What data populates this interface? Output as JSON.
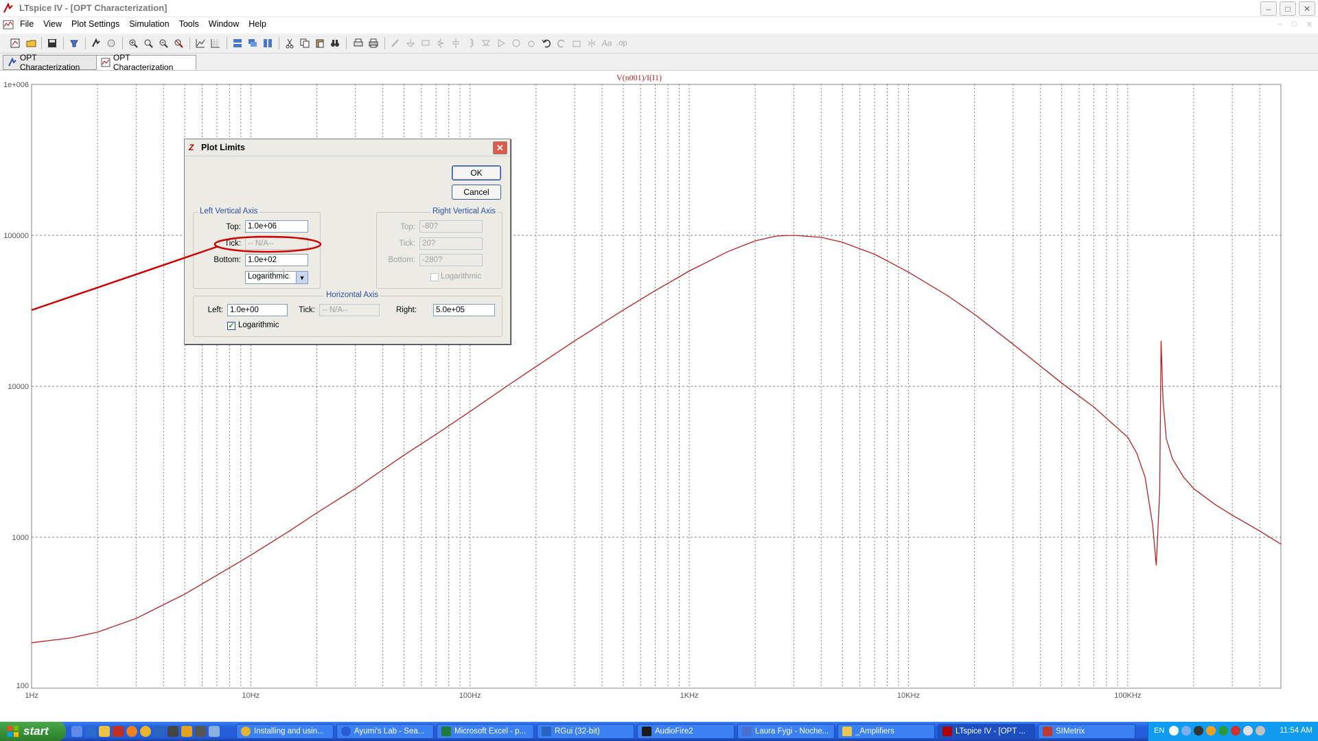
{
  "window": {
    "title": "LTspice IV - [OPT Characterization]"
  },
  "menu": [
    "File",
    "View",
    "Plot Settings",
    "Simulation",
    "Tools",
    "Window",
    "Help"
  ],
  "tabs": [
    {
      "label": "OPT Characterization",
      "icon": "schematic-icon",
      "active": false
    },
    {
      "label": "OPT Characterization",
      "icon": "waveform-icon",
      "active": true
    }
  ],
  "plot": {
    "trace_label": "V(n001)/I(I1)",
    "trace_color": "#b22222",
    "grid_color": "#808080"
  },
  "chart_data": {
    "type": "line",
    "title": "V(n001)/I(I1)",
    "xscale": "log",
    "yscale": "log",
    "xlim": [
      1,
      500000
    ],
    "ylim": [
      100,
      1000000
    ],
    "x_tick_labels": [
      "1Hz",
      "10Hz",
      "100Hz",
      "1KHz",
      "10KHz",
      "100KHz"
    ],
    "y_tick_labels": [
      "1e+006",
      "100000",
      "10000",
      "1000",
      "100"
    ],
    "grid": true,
    "series": [
      {
        "name": "V(n001)/I(I1)",
        "x": [
          1,
          1.5,
          2,
          3,
          5,
          7,
          10,
          15,
          20,
          30,
          50,
          70,
          100,
          150,
          200,
          300,
          500,
          700,
          1000,
          1500,
          2000,
          2500,
          3000,
          4000,
          5000,
          7000,
          10000,
          15000,
          20000,
          30000,
          50000,
          70000,
          100000,
          110000,
          120000,
          130000,
          135000,
          140000,
          142000,
          145000,
          150000,
          160000,
          180000,
          200000,
          250000,
          300000,
          400000,
          500000
        ],
        "y": [
          200,
          215,
          235,
          290,
          420,
          560,
          760,
          1100,
          1450,
          2100,
          3500,
          4800,
          6800,
          10200,
          13500,
          20000,
          32000,
          43000,
          58000,
          78000,
          92000,
          99000,
          100000,
          97000,
          90000,
          75000,
          57000,
          40000,
          30000,
          19000,
          10500,
          7300,
          4600,
          3600,
          2500,
          1200,
          650,
          2000,
          20000,
          8000,
          4500,
          3300,
          2500,
          2100,
          1650,
          1400,
          1100,
          900
        ]
      }
    ]
  },
  "dialog": {
    "title": "Plot Limits",
    "ok_label": "OK",
    "cancel_label": "Cancel",
    "left_axis": {
      "title": "Left Vertical Axis",
      "top_label": "Top:",
      "top_value": "1.0e+06",
      "tick_label": "Tick:",
      "tick_value": "-- N/A--",
      "bottom_label": "Bottom:",
      "bottom_value": "1.0e+02",
      "scale_value": "Logarithmic"
    },
    "right_axis": {
      "title": "Right Vertical Axis",
      "top_label": "Top:",
      "top_value": "-80?",
      "tick_label": "Tick:",
      "tick_value": "20?",
      "bottom_label": "Bottom:",
      "bottom_value": "-280?",
      "log_label": "Logarithmic",
      "log_checked": false
    },
    "horizontal_axis": {
      "title": "Horizontal Axis",
      "left_label": "Left:",
      "left_value": "1.0e+00",
      "tick_label": "Tick:",
      "tick_value": "-- N/A--",
      "right_label": "Right:",
      "right_value": "5.0e+05",
      "log_label": "Logarithmic",
      "log_checked": true
    }
  },
  "annotation": {
    "color": "#cc0000"
  },
  "taskbar": {
    "start_label": "start",
    "tasks": [
      {
        "label": "Installing and usin...",
        "icon": "chrome-icon",
        "color": "#e8b42c"
      },
      {
        "label": "Ayumi's Lab - Sea...",
        "icon": "firefox-icon",
        "color": "#2a5bd7"
      },
      {
        "label": "Microsoft Excel - p...",
        "icon": "excel-icon",
        "color": "#1d7a3a"
      },
      {
        "label": "RGui (32-bit)",
        "icon": "r-icon",
        "color": "#2b64c0"
      },
      {
        "label": "AudioFire2",
        "icon": "audiofire-icon",
        "color": "#1a1a1a"
      },
      {
        "label": "Laura Fygi - Noche...",
        "icon": "music-icon",
        "color": "#4a6fd0"
      },
      {
        "label": "_Amplifiers",
        "icon": "folder-icon",
        "color": "#e8c84c"
      },
      {
        "label": "LTspice IV - [OPT ...",
        "icon": "ltspice-icon",
        "color": "#b00000",
        "active": true
      },
      {
        "label": "SIMetrix",
        "icon": "simetrix-icon",
        "color": "#c0392b"
      }
    ],
    "lang": "EN",
    "clock": "11:54 AM"
  }
}
